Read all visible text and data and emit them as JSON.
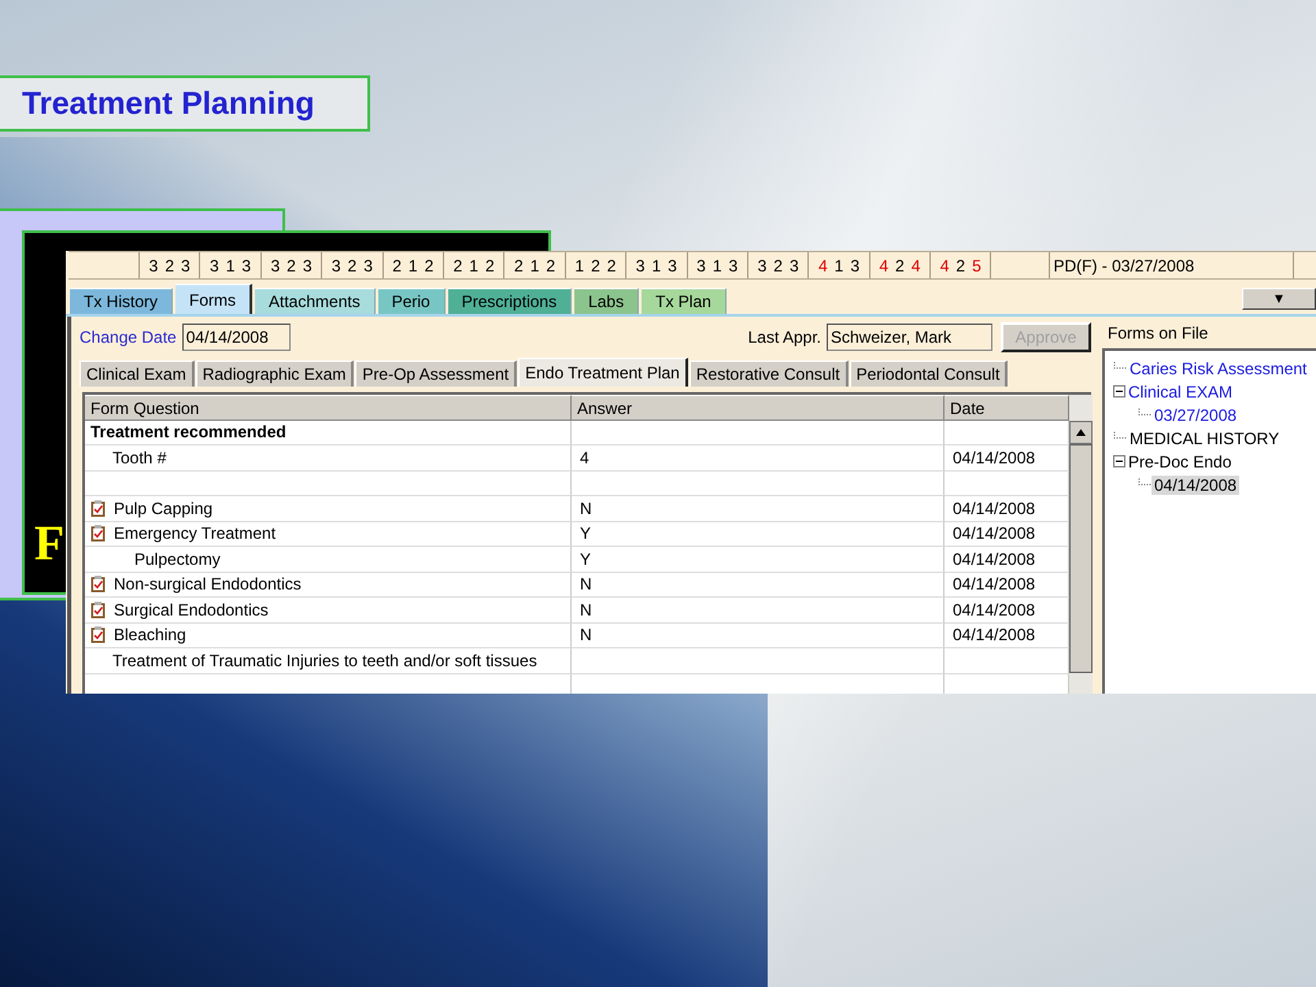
{
  "slide": {
    "title": "Treatment Planning",
    "backdrop_letter": "F"
  },
  "chart_row": {
    "groups": [
      {
        "digits": [
          {
            "text": "3",
            "color": "#000000"
          },
          {
            "text": "2",
            "color": "#000000"
          },
          {
            "text": "3",
            "color": "#000000"
          }
        ]
      },
      {
        "digits": [
          {
            "text": "3",
            "color": "#000000"
          },
          {
            "text": "1",
            "color": "#000000"
          },
          {
            "text": "3",
            "color": "#000000"
          }
        ]
      },
      {
        "digits": [
          {
            "text": "3",
            "color": "#000000"
          },
          {
            "text": "2",
            "color": "#000000"
          },
          {
            "text": "3",
            "color": "#000000"
          }
        ]
      },
      {
        "digits": [
          {
            "text": "3",
            "color": "#000000"
          },
          {
            "text": "2",
            "color": "#000000"
          },
          {
            "text": "3",
            "color": "#000000"
          }
        ]
      },
      {
        "digits": [
          {
            "text": "2",
            "color": "#000000"
          },
          {
            "text": "1",
            "color": "#000000"
          },
          {
            "text": "2",
            "color": "#000000"
          }
        ]
      },
      {
        "digits": [
          {
            "text": "2",
            "color": "#000000"
          },
          {
            "text": "1",
            "color": "#000000"
          },
          {
            "text": "2",
            "color": "#000000"
          }
        ]
      },
      {
        "digits": [
          {
            "text": "2",
            "color": "#000000"
          },
          {
            "text": "1",
            "color": "#000000"
          },
          {
            "text": "2",
            "color": "#000000"
          }
        ]
      },
      {
        "digits": [
          {
            "text": "1",
            "color": "#000000"
          },
          {
            "text": "2",
            "color": "#000000"
          },
          {
            "text": "2",
            "color": "#000000"
          }
        ]
      },
      {
        "digits": [
          {
            "text": "3",
            "color": "#000000"
          },
          {
            "text": "1",
            "color": "#000000"
          },
          {
            "text": "3",
            "color": "#000000"
          }
        ]
      },
      {
        "digits": [
          {
            "text": "3",
            "color": "#000000"
          },
          {
            "text": "1",
            "color": "#000000"
          },
          {
            "text": "3",
            "color": "#000000"
          }
        ]
      },
      {
        "digits": [
          {
            "text": "3",
            "color": "#000000"
          },
          {
            "text": "2",
            "color": "#000000"
          },
          {
            "text": "3",
            "color": "#000000"
          }
        ]
      },
      {
        "digits": [
          {
            "text": "4",
            "color": "#e00000"
          },
          {
            "text": "1",
            "color": "#000000"
          },
          {
            "text": "3",
            "color": "#000000"
          }
        ]
      },
      {
        "digits": [
          {
            "text": "4",
            "color": "#e00000"
          },
          {
            "text": "2",
            "color": "#000000"
          },
          {
            "text": "4",
            "color": "#e00000"
          }
        ]
      },
      {
        "digits": [
          {
            "text": "4",
            "color": "#e00000"
          },
          {
            "text": "2",
            "color": "#000000"
          },
          {
            "text": "5",
            "color": "#e00000"
          }
        ]
      }
    ],
    "summary": "PD(F) - 03/27/2008"
  },
  "tabs": [
    {
      "label": "Tx History",
      "selected": false,
      "color": "#7db8dc"
    },
    {
      "label": "Forms",
      "selected": true,
      "color": "#c4e3f6"
    },
    {
      "label": "Attachments",
      "selected": false,
      "color": "#a8dcdc"
    },
    {
      "label": "Perio",
      "selected": false,
      "color": "#78c6c4"
    },
    {
      "label": "Prescriptions",
      "selected": false,
      "color": "#4fb096"
    },
    {
      "label": "Labs",
      "selected": false,
      "color": "#8cc48e"
    },
    {
      "label": "Tx Plan",
      "selected": false,
      "color": "#a6d89c"
    }
  ],
  "dropdown_button": {
    "label": "▼"
  },
  "form_header": {
    "change_date_label": "Change Date",
    "change_date": "04/14/2008",
    "last_appr_label": "Last Appr.",
    "last_appr": "Schweizer, Mark",
    "approve_button": {
      "label": "Approve",
      "disabled": true
    }
  },
  "sub_tabs": [
    {
      "label": "Clinical Exam",
      "selected": false
    },
    {
      "label": "Radiographic Exam",
      "selected": false
    },
    {
      "label": "Pre-Op Assessment",
      "selected": false
    },
    {
      "label": "Endo Treatment Plan",
      "selected": true
    },
    {
      "label": "Restorative Consult",
      "selected": false
    },
    {
      "label": "Periodontal Consult",
      "selected": false
    }
  ],
  "table": {
    "columns": [
      "Form Question",
      "Answer",
      "Date"
    ],
    "rows": [
      {
        "kind": "heading",
        "question": "Treatment recommended"
      },
      {
        "kind": "field",
        "question": "Tooth #",
        "answer": "4",
        "date": "04/14/2008"
      },
      {
        "kind": "blank"
      },
      {
        "kind": "form",
        "question": "Pulp Capping",
        "answer": "N",
        "date": "04/14/2008"
      },
      {
        "kind": "form",
        "question": "Emergency Treatment",
        "answer": "Y",
        "date": "04/14/2008"
      },
      {
        "kind": "sub",
        "question": "Pulpectomy",
        "answer": "Y",
        "date": "04/14/2008"
      },
      {
        "kind": "form",
        "question": "Non-surgical Endodontics",
        "answer": "N",
        "date": "04/14/2008"
      },
      {
        "kind": "form",
        "question": "Surgical Endodontics",
        "answer": "N",
        "date": "04/14/2008"
      },
      {
        "kind": "form",
        "question": "Bleaching",
        "answer": "N",
        "date": "04/14/2008"
      },
      {
        "kind": "field",
        "question": "Treatment of Traumatic Injuries to teeth and/or soft tissues"
      },
      {
        "kind": "blank"
      }
    ]
  },
  "forms_on_file": {
    "title": "Forms on File",
    "items": [
      {
        "label": "Caries Risk Assessment",
        "color": "#1a1ae0",
        "selected": false
      },
      {
        "label": "Clinical EXAM",
        "color": "#1a1ae0",
        "selected": false,
        "expanded": true,
        "children": [
          {
            "label": "03/27/2008",
            "color": "#1a1ae0",
            "selected": false
          }
        ]
      },
      {
        "label": "MEDICAL HISTORY",
        "color": "#000000",
        "selected": false
      },
      {
        "label": "Pre-Doc Endo",
        "color": "#000000",
        "selected": false,
        "expanded": true,
        "children": [
          {
            "label": "04/14/2008",
            "color": "#000000",
            "selected": true
          }
        ]
      }
    ]
  }
}
